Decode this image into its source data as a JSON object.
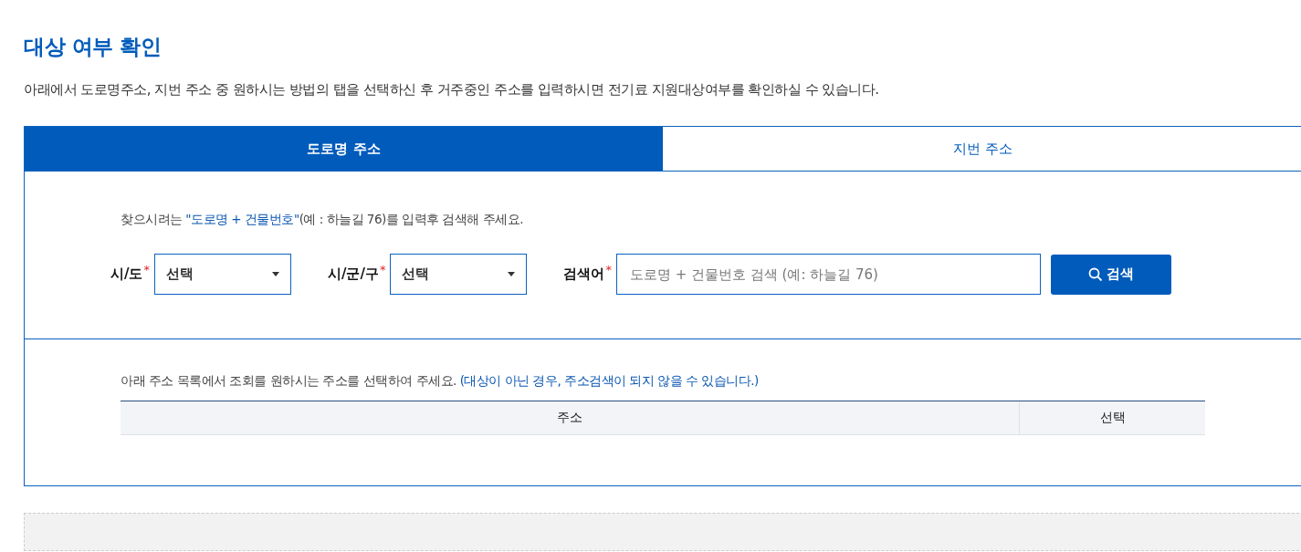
{
  "title": "대상 여부 확인",
  "description": "아래에서 도로명주소, 지번 주소 중 원하시는 방법의 탭을 선택하신 후 거주중인 주소를 입력하시면 전기료 지원대상여부를 확인하실 수 있습니다.",
  "tabs": [
    {
      "label": "도로명 주소",
      "selected": true
    },
    {
      "label": "지번 주소",
      "selected": false
    }
  ],
  "hint": [
    {
      "text": "찾으시려는 ",
      "highlight": false
    },
    {
      "text": "\"도로명 + 건물번호\"",
      "highlight": true
    },
    {
      "text": "(예 : 하늘길 76)를 입력후 검색해 주세요.",
      "highlight": false
    }
  ],
  "fields": [
    {
      "kind": "select",
      "label": "시/도",
      "required_mark": "*",
      "value": "선택"
    },
    {
      "kind": "select",
      "label": "시/군/구",
      "required_mark": "*",
      "value": "선택"
    },
    {
      "kind": "input",
      "label": "검색어",
      "required_mark": "*",
      "placeholder": "도로명 + 건물번호 검색 (예: 하늘길 76)"
    }
  ],
  "search_button": "검색",
  "result_note": [
    {
      "text": "아래 주소 목록에서 조회를 원하시는 주소를 선택하여 주세요. ",
      "highlight": false
    },
    {
      "text": "(대상이 아닌 경우, 주소검색이 되지 않을 수 있습니다.)",
      "highlight": true
    }
  ],
  "table": {
    "columns": [
      "주소",
      "선택"
    ]
  }
}
